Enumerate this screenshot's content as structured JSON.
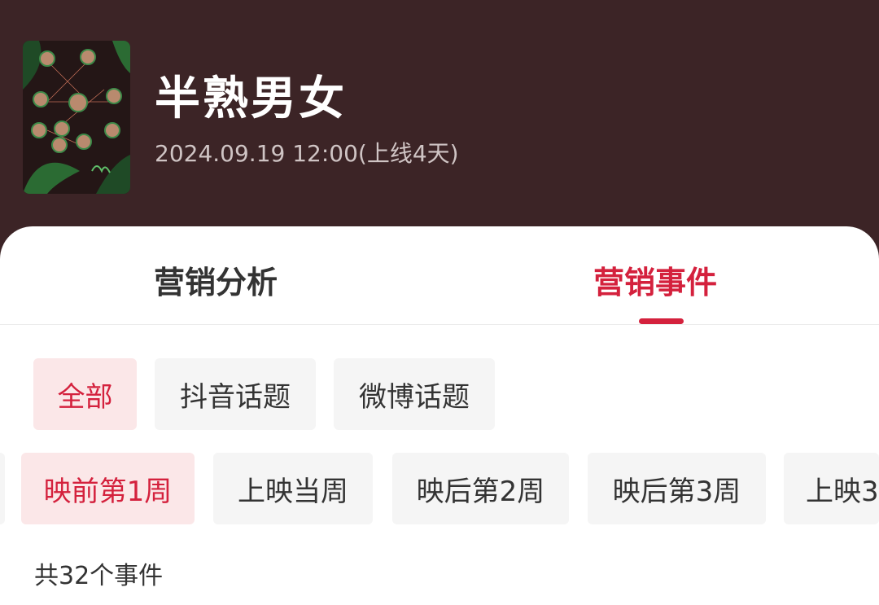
{
  "header": {
    "title": "半熟男女",
    "subtitle": "2024.09.19 12:00(上线4天)"
  },
  "tabs": [
    {
      "label": "营销分析",
      "active": false
    },
    {
      "label": "营销事件",
      "active": true
    }
  ],
  "platform_filters": [
    {
      "label": "全部",
      "active": true
    },
    {
      "label": "抖音话题",
      "active": false
    },
    {
      "label": "微博话题",
      "active": false
    }
  ],
  "week_filters": [
    {
      "label": "映前第1周",
      "active": true
    },
    {
      "label": "上映当周",
      "active": false
    },
    {
      "label": "映后第2周",
      "active": false
    },
    {
      "label": "映后第3周",
      "active": false
    },
    {
      "label": "上映3",
      "active": false
    }
  ],
  "summary": {
    "count_text": "共32个事件"
  },
  "colors": {
    "header_bg": "#3c2426",
    "accent": "#d4213d",
    "chip_bg": "#f5f5f5",
    "chip_active_bg": "#fbe7e8"
  },
  "icons": [
    "poster-image"
  ]
}
